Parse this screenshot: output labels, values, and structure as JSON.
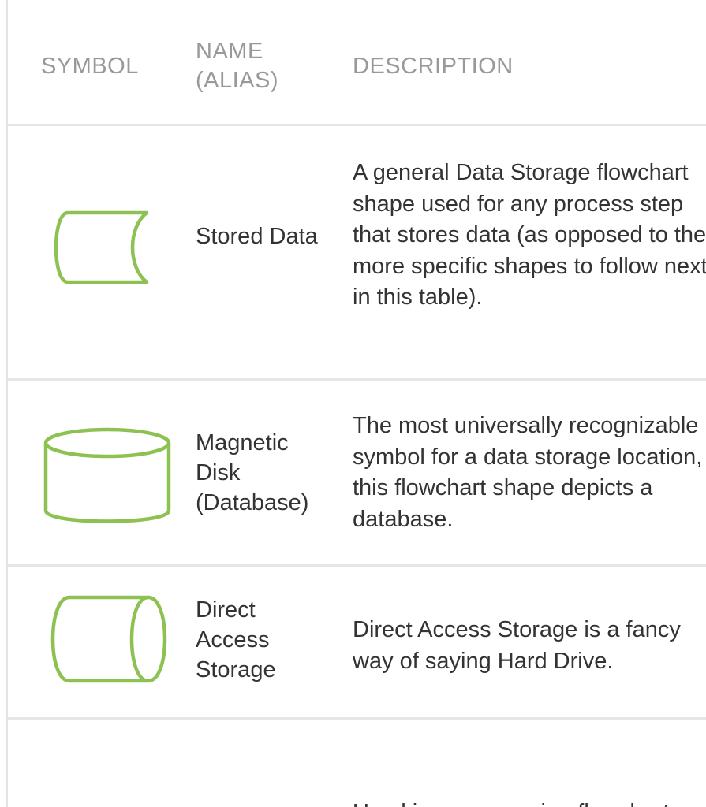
{
  "headers": {
    "symbol": "SYMBOL",
    "name": "NAME (ALIAS)",
    "description": "DESCRIPTION"
  },
  "rows": [
    {
      "icon": "stored-data-icon",
      "name": "Stored Data",
      "description": "A general Data Storage flowchart shape used for any process step that stores data (as opposed to the more specific shapes to follow next in this table)."
    },
    {
      "icon": "magnetic-disk-icon",
      "name": "Magnetic Disk (Database)",
      "description": "The most universally recognizable symbol for a data storage location, this flowchart shape depicts a database."
    },
    {
      "icon": "direct-access-storage-icon",
      "name": "Direct Access Storage",
      "description": "Direct Access Storage is a fancy way of saying Hard Drive."
    },
    {
      "icon": "",
      "name": "",
      "description": "Used in programming flowcharts"
    }
  ],
  "colors": {
    "shape_stroke": "#8dc152",
    "header_text": "#999999",
    "body_text": "#333333",
    "divider": "#e6e6e6"
  }
}
